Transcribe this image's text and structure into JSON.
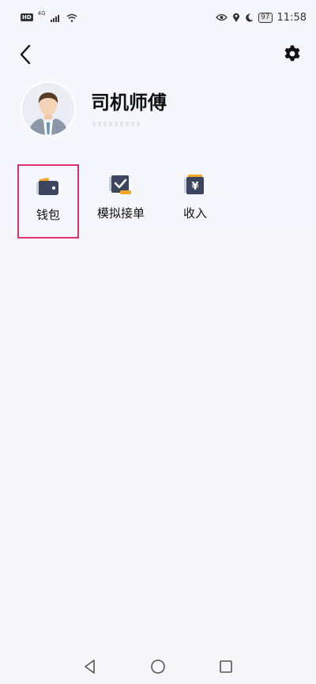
{
  "status_bar": {
    "hd": "HD",
    "network": "4G",
    "battery": "97",
    "time": "11:58",
    "icons": [
      "signal-icon",
      "wifi-icon",
      "eye-icon",
      "location-icon",
      "moon-icon"
    ]
  },
  "header": {
    "back_icon": "chevron-left-icon",
    "settings_icon": "gear-icon"
  },
  "profile": {
    "name": "司机师傅",
    "avatar_icon": "driver-avatar-icon"
  },
  "menu": {
    "items": [
      {
        "label": "钱包",
        "icon": "wallet-icon",
        "selected": true
      },
      {
        "label": "模拟接单",
        "icon": "simulate-order-icon",
        "selected": false
      },
      {
        "label": "收入",
        "icon": "income-icon",
        "selected": false
      }
    ]
  },
  "colors": {
    "accent_highlight": "#e0306f",
    "icon_dark": "#3b4560",
    "icon_orange": "#f5a623",
    "background": "#f5f7fc"
  },
  "nav_bar": {
    "icons": [
      "back-triangle-icon",
      "home-circle-icon",
      "recents-square-icon"
    ]
  }
}
